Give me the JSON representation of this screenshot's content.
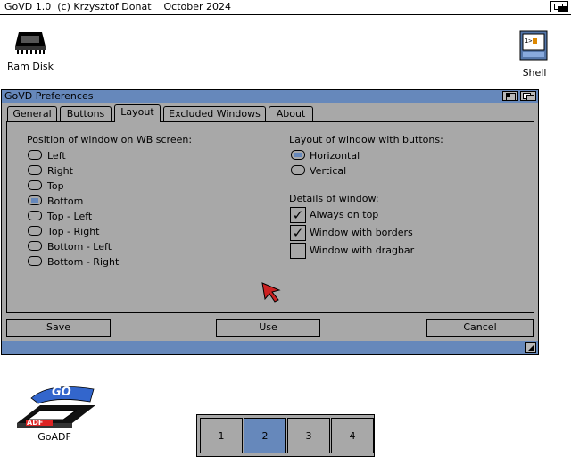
{
  "screen": {
    "title": "GoVD 1.0  (c) Krzysztof Donat    October 2024"
  },
  "desktop_icons": {
    "ram_disk": "Ram Disk",
    "shell": "Shell",
    "goadf": "GoADF",
    "goadf_badge": "ADF",
    "goadf_logo": "GO"
  },
  "window": {
    "title": "GoVD Preferences",
    "tabs": [
      "General",
      "Buttons",
      "Layout",
      "Excluded Windows",
      "About"
    ],
    "active_tab": "Layout",
    "position_heading": "Position of window on WB screen:",
    "positions": [
      "Left",
      "Right",
      "Top",
      "Bottom",
      "Top - Left",
      "Top - Right",
      "Bottom - Left",
      "Bottom - Right"
    ],
    "selected_position": "Bottom",
    "layout_heading": "Layout of window with buttons:",
    "layouts": [
      "Horizontal",
      "Vertical"
    ],
    "selected_layout": "Horizontal",
    "details_heading": "Details of window:",
    "details": [
      {
        "label": "Always on top",
        "checked": true
      },
      {
        "label": "Window with borders",
        "checked": true
      },
      {
        "label": "Window with dragbar",
        "checked": false
      }
    ],
    "buttons": {
      "save": "Save",
      "use": "Use",
      "cancel": "Cancel"
    }
  },
  "switcher": {
    "desktops": [
      "1",
      "2",
      "3",
      "4"
    ],
    "active": "2"
  },
  "colors": {
    "accent": "#6688bb",
    "window_bg": "#a8a8a8"
  }
}
